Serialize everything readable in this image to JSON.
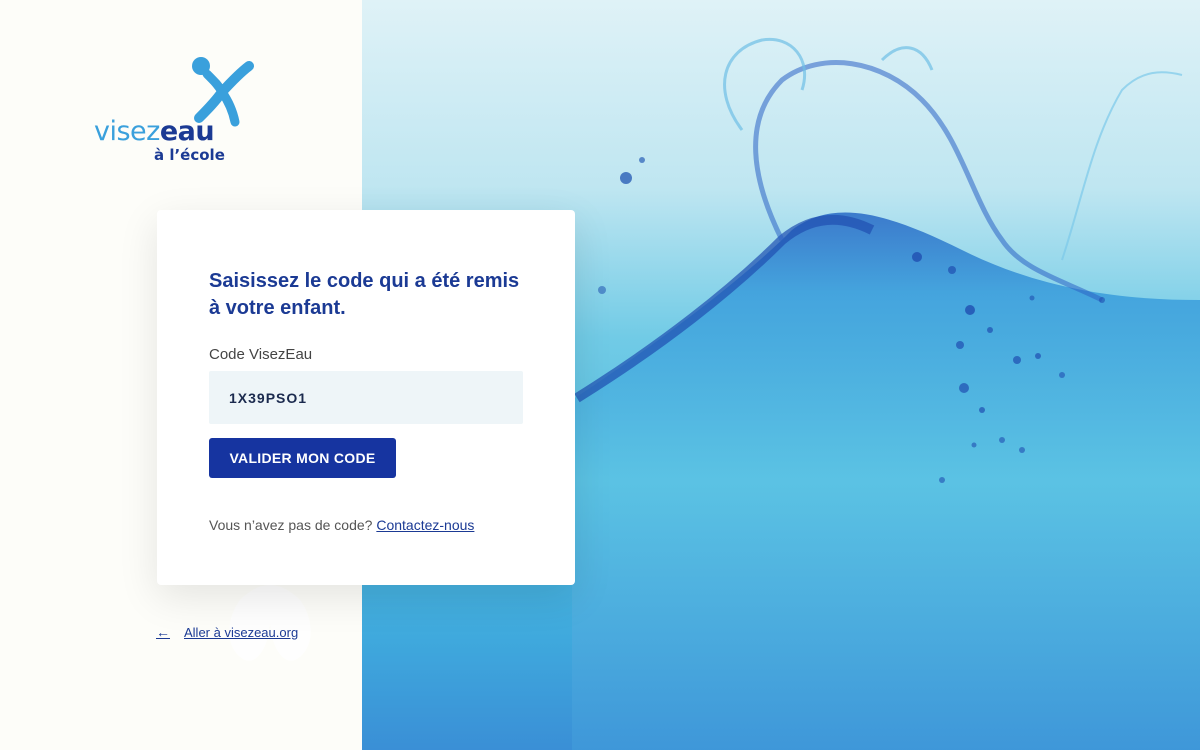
{
  "brand": {
    "name_light": "visez",
    "name_bold": "eau",
    "subtitle": "à l’école",
    "accent_color": "#3aa0dc",
    "primary_color": "#1b3a94",
    "logo_icon": "person-splash-icon"
  },
  "card": {
    "title": "Saisissez le code qui a été remis à votre enfant.",
    "field_label": "Code VisezEau",
    "code_value": "1X39PSO1",
    "submit_label": "VALIDER MON CODE",
    "help_text": "Vous n’avez pas de code?",
    "help_link": "Contactez-nous"
  },
  "footer": {
    "back_icon": "arrow-left-icon",
    "back_label": "Aller à visezeau.org"
  },
  "hero": {
    "image": "water-splash-wave"
  }
}
